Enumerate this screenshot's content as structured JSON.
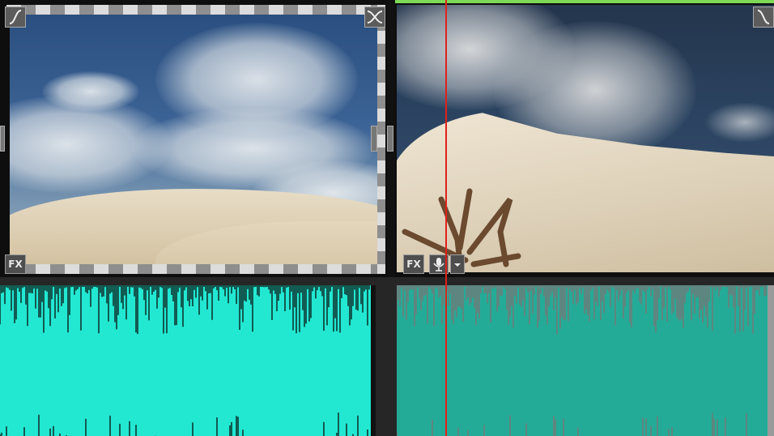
{
  "clip1": {
    "fx_label": "FX",
    "fade_in_icon": "fade-in-curve-icon",
    "crossfade_icon": "crossfade-icon"
  },
  "clip2": {
    "fx_label": "FX",
    "fade_out_icon": "fade-out-curve-icon",
    "mic_icon": "microphone-icon",
    "dropdown_icon": "chevron-down-icon"
  },
  "colors": {
    "audio_selected": "#22e8d2",
    "audio_unselected": "#24ab97",
    "playhead": "#e0201a",
    "selection_border": "#7ed957"
  }
}
